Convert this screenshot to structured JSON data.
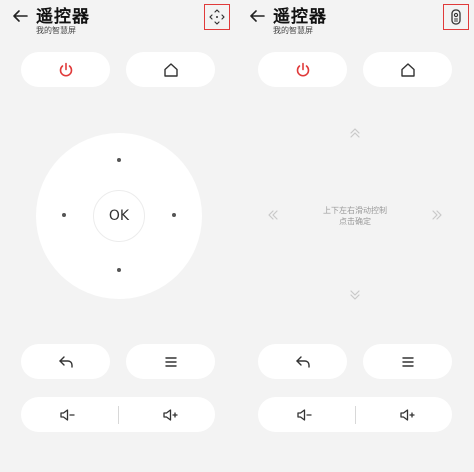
{
  "left_screen": {
    "title": "遥控器",
    "subtitle": "我的智慧屏",
    "ok_label": "OK",
    "icons": {
      "back": "arrow-left-icon",
      "mode": "dpad-mode-icon",
      "power": "power-icon",
      "home": "home-icon",
      "return": "return-icon",
      "menu": "menu-icon",
      "volume_down": "volume-down-icon",
      "volume_up": "volume-up-icon"
    }
  },
  "right_screen": {
    "title": "遥控器",
    "subtitle": "我的智慧屏",
    "hint_line1": "上下左右滑动控制",
    "hint_line2": "点击确定",
    "icons": {
      "back": "arrow-left-icon",
      "mode": "remote-mode-icon",
      "power": "power-icon",
      "home": "home-icon",
      "return": "return-icon",
      "menu": "menu-icon",
      "volume_down": "volume-down-icon",
      "volume_up": "volume-up-icon",
      "swipe": "chevron-icon"
    }
  },
  "colors": {
    "background": "#f3f3f3",
    "button": "#ffffff",
    "power_accent": "#e03a3a",
    "highlight_border": "#e03a3a",
    "hint_text": "#9a9a9a"
  }
}
